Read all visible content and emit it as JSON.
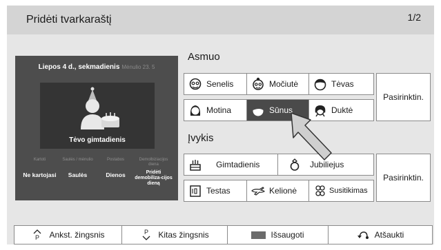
{
  "header": {
    "title": "Pridėti tvarkaraštį",
    "page_indicator": "1/2"
  },
  "preview": {
    "date": "Liepos 4 d., sekmadienis",
    "lunar_date": "Mėnulio 23. 5",
    "event_title": "Tėvo gimtadienis",
    "options": [
      {
        "header": "Kartoti",
        "value": "Ne kartojasi"
      },
      {
        "header": "Saulės / mėnulio",
        "value": "Saulės"
      },
      {
        "header": "Postabos",
        "value": "Dienos"
      },
      {
        "header": "Demolbiziacijos diena",
        "value": "Pridėti demobiliza-cijos dieną"
      }
    ]
  },
  "person_section": {
    "label": "Asmuo",
    "items": [
      {
        "label": "Senelis",
        "icon": "grandfather-icon"
      },
      {
        "label": "Močiutė",
        "icon": "grandmother-icon"
      },
      {
        "label": "Tėvas",
        "icon": "father-icon"
      },
      {
        "label": "Motina",
        "icon": "mother-icon"
      },
      {
        "label": "Sūnus",
        "icon": "son-icon",
        "selected": true
      },
      {
        "label": "Duktė",
        "icon": "daughter-icon"
      }
    ],
    "custom_label": "Pasirinktin."
  },
  "event_section": {
    "label": "Įvykis",
    "items": [
      {
        "label": "Gimtadienis",
        "icon": "birthday-cake-icon"
      },
      {
        "label": "Jubiliejus",
        "icon": "ring-icon"
      },
      {
        "label": "Testas",
        "icon": "test-icon"
      },
      {
        "label": "Kelionė",
        "icon": "airplane-icon"
      },
      {
        "label": "Susitikimas",
        "icon": "meeting-icon"
      }
    ],
    "custom_label": "Pasirinktin."
  },
  "bottom_bar": {
    "prev_step": "Ankst. žingsnis",
    "next_step": "Kitas žingsnis",
    "save": "Išsaugoti",
    "cancel": "Atšaukti"
  },
  "colors": {
    "selected": "#4a4a4a",
    "dialog_bg": "#e6e6e6",
    "title_bg": "#d4d4d4",
    "preview_bg": "#4d4d4d"
  }
}
